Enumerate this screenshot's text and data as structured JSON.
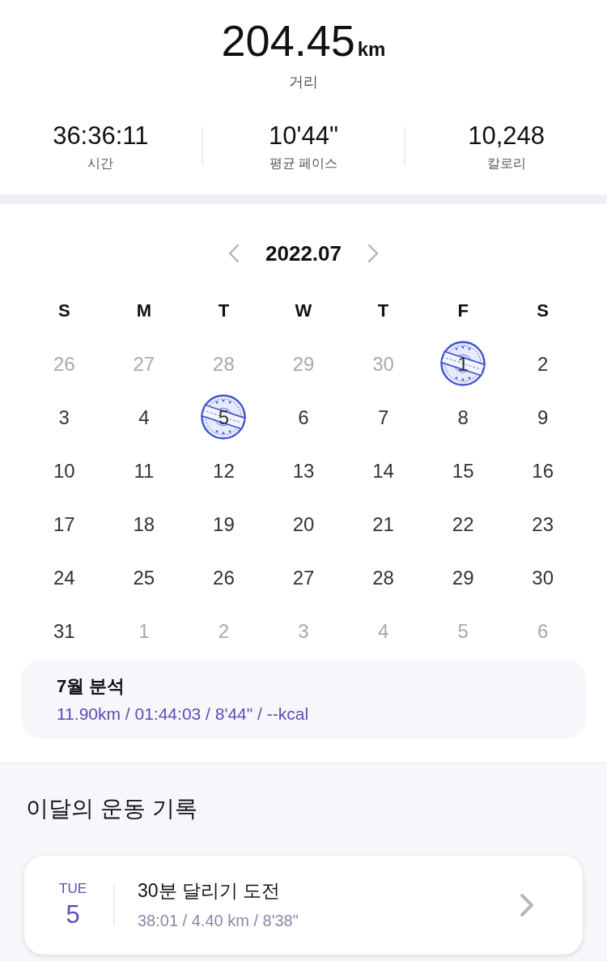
{
  "summary": {
    "distance": {
      "value": "204.45",
      "unit": "km",
      "label": "거리"
    },
    "stats": [
      {
        "value": "36:36:11",
        "label": "시간"
      },
      {
        "value": "10'44\"",
        "label": "평균 페이스"
      },
      {
        "value": "10,248",
        "label": "칼로리"
      }
    ]
  },
  "calendar": {
    "month": "2022.07",
    "weekdays": [
      "S",
      "M",
      "T",
      "W",
      "T",
      "F",
      "S"
    ],
    "weeks": [
      {
        "days": [
          {
            "day": "26",
            "in_month": false,
            "stamped": false
          },
          {
            "day": "27",
            "in_month": false,
            "stamped": false
          },
          {
            "day": "28",
            "in_month": false,
            "stamped": false
          },
          {
            "day": "29",
            "in_month": false,
            "stamped": false
          },
          {
            "day": "30",
            "in_month": false,
            "stamped": false
          },
          {
            "day": "1",
            "in_month": true,
            "stamped": true
          },
          {
            "day": "2",
            "in_month": true,
            "stamped": false
          }
        ]
      },
      {
        "days": [
          {
            "day": "3",
            "in_month": true,
            "stamped": false
          },
          {
            "day": "4",
            "in_month": true,
            "stamped": false
          },
          {
            "day": "5",
            "in_month": true,
            "stamped": true
          },
          {
            "day": "6",
            "in_month": true,
            "stamped": false
          },
          {
            "day": "7",
            "in_month": true,
            "stamped": false
          },
          {
            "day": "8",
            "in_month": true,
            "stamped": false
          },
          {
            "day": "9",
            "in_month": true,
            "stamped": false
          }
        ]
      },
      {
        "days": [
          {
            "day": "10",
            "in_month": true,
            "stamped": false
          },
          {
            "day": "11",
            "in_month": true,
            "stamped": false
          },
          {
            "day": "12",
            "in_month": true,
            "stamped": false
          },
          {
            "day": "13",
            "in_month": true,
            "stamped": false
          },
          {
            "day": "14",
            "in_month": true,
            "stamped": false
          },
          {
            "day": "15",
            "in_month": true,
            "stamped": false
          },
          {
            "day": "16",
            "in_month": true,
            "stamped": false
          }
        ]
      },
      {
        "days": [
          {
            "day": "17",
            "in_month": true,
            "stamped": false
          },
          {
            "day": "18",
            "in_month": true,
            "stamped": false
          },
          {
            "day": "19",
            "in_month": true,
            "stamped": false
          },
          {
            "day": "20",
            "in_month": true,
            "stamped": false
          },
          {
            "day": "21",
            "in_month": true,
            "stamped": false
          },
          {
            "day": "22",
            "in_month": true,
            "stamped": false
          },
          {
            "day": "23",
            "in_month": true,
            "stamped": false
          }
        ]
      },
      {
        "days": [
          {
            "day": "24",
            "in_month": true,
            "stamped": false
          },
          {
            "day": "25",
            "in_month": true,
            "stamped": false
          },
          {
            "day": "26",
            "in_month": true,
            "stamped": false
          },
          {
            "day": "27",
            "in_month": true,
            "stamped": false
          },
          {
            "day": "28",
            "in_month": true,
            "stamped": false
          },
          {
            "day": "29",
            "in_month": true,
            "stamped": false
          },
          {
            "day": "30",
            "in_month": true,
            "stamped": false
          }
        ]
      },
      {
        "days": [
          {
            "day": "31",
            "in_month": true,
            "stamped": false
          },
          {
            "day": "1",
            "in_month": false,
            "stamped": false
          },
          {
            "day": "2",
            "in_month": false,
            "stamped": false
          },
          {
            "day": "3",
            "in_month": false,
            "stamped": false
          },
          {
            "day": "4",
            "in_month": false,
            "stamped": false
          },
          {
            "day": "5",
            "in_month": false,
            "stamped": false
          },
          {
            "day": "6",
            "in_month": false,
            "stamped": false
          }
        ]
      }
    ]
  },
  "analysis": {
    "title": "7월 분석",
    "summary": "11.90km / 01:44:03 / 8'44\" / --kcal"
  },
  "records": {
    "title": "이달의 운동 기록",
    "items": [
      {
        "weekday": "TUE",
        "day": "5",
        "title": "30분 달리기 도전",
        "details": "38:01 / 4.40 km / 8'38\""
      }
    ]
  }
}
